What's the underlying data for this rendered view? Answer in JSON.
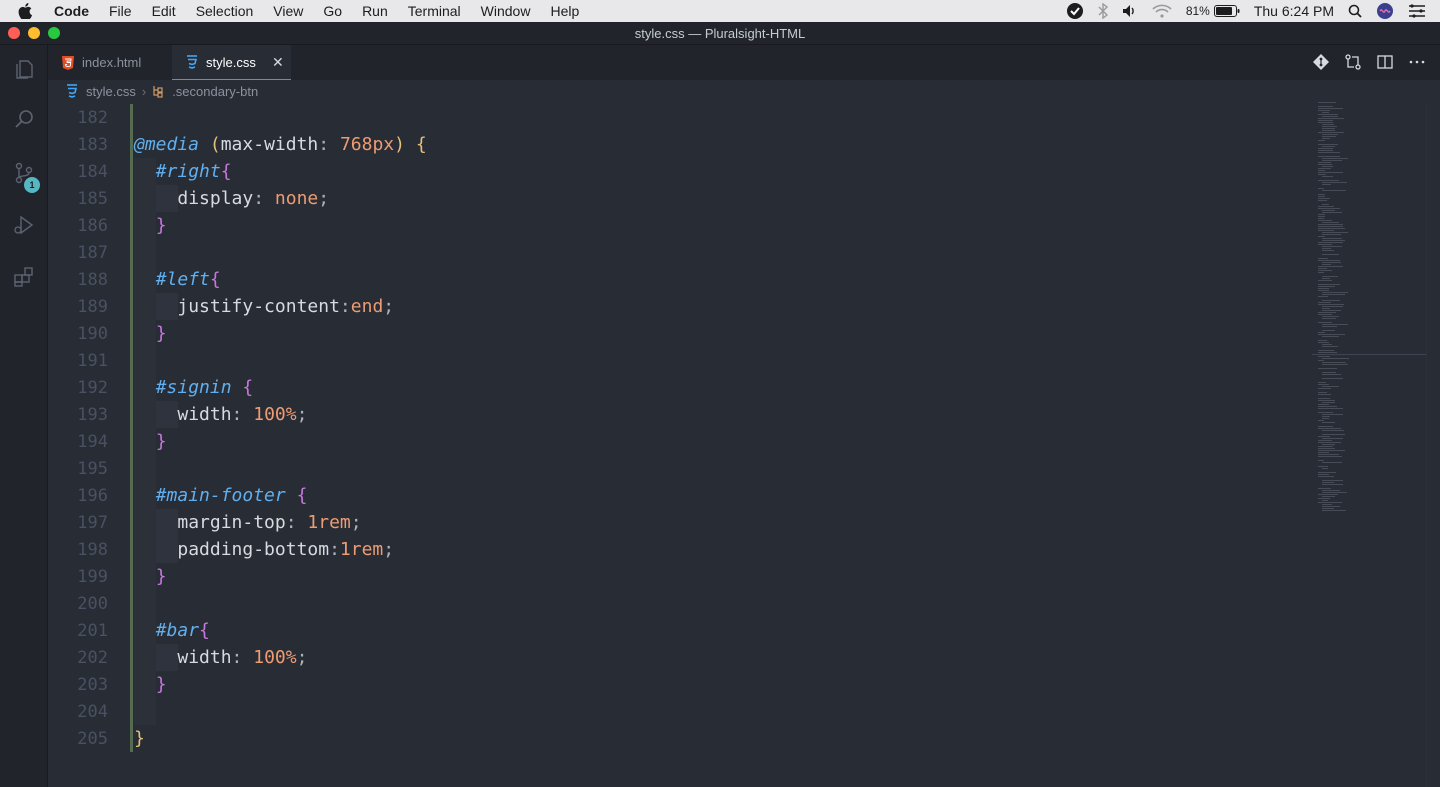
{
  "menubar": {
    "app": "Code",
    "items": [
      "File",
      "Edit",
      "Selection",
      "View",
      "Go",
      "Run",
      "Terminal",
      "Window",
      "Help"
    ],
    "battery": "81%",
    "clock": "Thu 6:24 PM"
  },
  "window": {
    "title": "style.css — Pluralsight-HTML"
  },
  "activity": {
    "source_control_badge": "1"
  },
  "tabs": [
    {
      "label": "index.html",
      "icon": "html-file-icon",
      "active": false
    },
    {
      "label": "style.css",
      "icon": "css-file-icon",
      "active": true
    }
  ],
  "breadcrumb": {
    "file": "style.css",
    "symbol": ".secondary-btn"
  },
  "editor": {
    "lines": [
      {
        "n": "182"
      },
      {
        "n": "183"
      },
      {
        "n": "184"
      },
      {
        "n": "185"
      },
      {
        "n": "186"
      },
      {
        "n": "187"
      },
      {
        "n": "188"
      },
      {
        "n": "189"
      },
      {
        "n": "190"
      },
      {
        "n": "191"
      },
      {
        "n": "192"
      },
      {
        "n": "193"
      },
      {
        "n": "194"
      },
      {
        "n": "195"
      },
      {
        "n": "196"
      },
      {
        "n": "197"
      },
      {
        "n": "198"
      },
      {
        "n": "199"
      },
      {
        "n": "200"
      },
      {
        "n": "201"
      },
      {
        "n": "202"
      },
      {
        "n": "203"
      },
      {
        "n": "204"
      },
      {
        "n": "205"
      }
    ],
    "tokens": {
      "l183_at": "@media",
      "l183_open": "(",
      "l183_prop": "max-width",
      "l183_colon": ": ",
      "l183_val": "768px",
      "l183_close": ")",
      "l183_brace": " {",
      "l184_sel": "#right",
      "l184_brace": "{",
      "l185_prop": "display",
      "l185_colon": ": ",
      "l185_val": "none",
      "l185_semi": ";",
      "l186_brace": "}",
      "l188_sel": "#left",
      "l188_brace": "{",
      "l189_prop": "justify-content",
      "l189_colon": ":",
      "l189_val": "end",
      "l189_semi": ";",
      "l190_brace": "}",
      "l192_sel": "#signin",
      "l192_brace": " {",
      "l193_prop": "width",
      "l193_colon": ": ",
      "l193_val": "100%",
      "l193_semi": ";",
      "l194_brace": "}",
      "l196_sel": "#main-footer",
      "l196_brace": " {",
      "l197_prop": "margin-top",
      "l197_colon": ": ",
      "l197_val": "1rem",
      "l197_semi": ";",
      "l198_prop": "padding-bottom",
      "l198_colon": ":",
      "l198_val": "1rem",
      "l198_semi": ";",
      "l199_brace": "}",
      "l201_sel": "#bar",
      "l201_brace": "{",
      "l202_prop": "width",
      "l202_colon": ": ",
      "l202_val": "100%",
      "l202_semi": ";",
      "l203_brace": "}",
      "l205_brace": "}"
    }
  },
  "colors": {
    "editor_bg": "#282c34",
    "sidebar_bg": "#21252b",
    "selector": "#61afef",
    "brace": "#c678dd",
    "value": "#ee9c72",
    "media_brace": "#e5c07b"
  }
}
